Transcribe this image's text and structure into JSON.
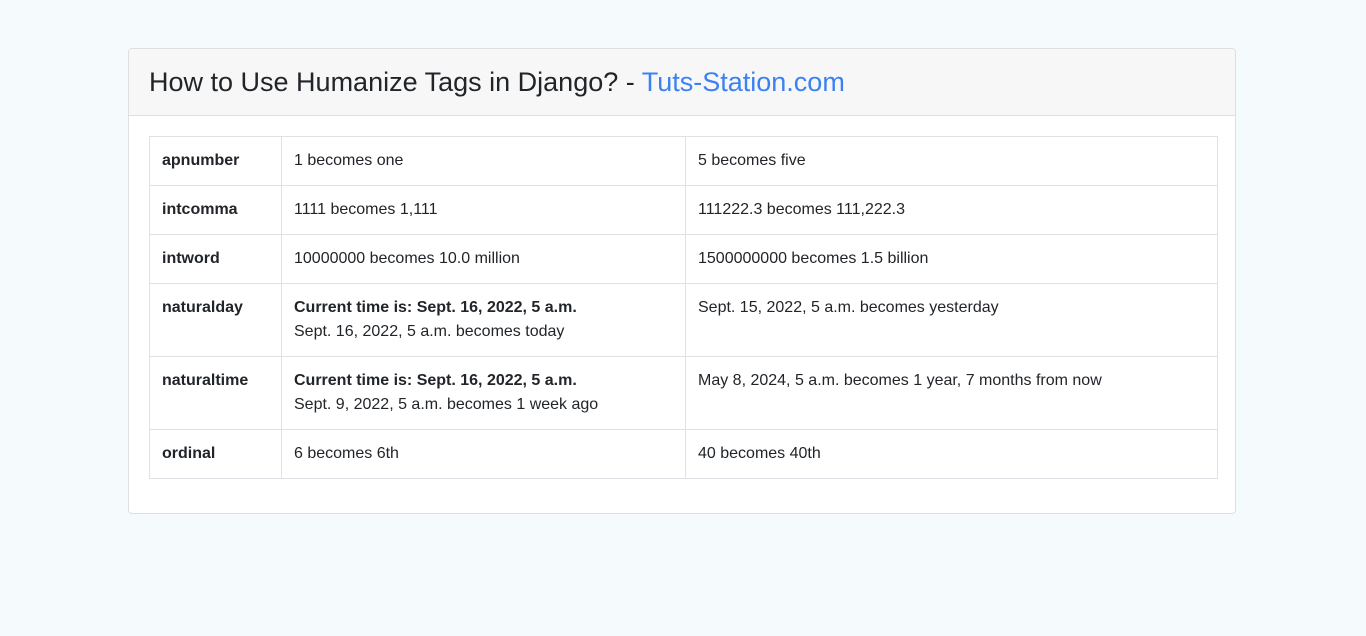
{
  "header": {
    "title": "How to Use Humanize Tags in Django? - ",
    "site_link": "Tuts-Station.com",
    "accent_color": "#3b82f0"
  },
  "rows": [
    {
      "label": "apnumber",
      "c1_bold": "",
      "c1_text": "1 becomes one",
      "c2_text": "5 becomes five"
    },
    {
      "label": "intcomma",
      "c1_bold": "",
      "c1_text": "1111 becomes 1,111",
      "c2_text": "111222.3 becomes 111,222.3"
    },
    {
      "label": "intword",
      "c1_bold": "",
      "c1_text": "10000000 becomes 10.0 million",
      "c2_text": "1500000000 becomes 1.5 billion"
    },
    {
      "label": "naturalday",
      "c1_bold": "Current time is: Sept. 16, 2022, 5 a.m.",
      "c1_text": "Sept. 16, 2022, 5 a.m. becomes today",
      "c2_text": "Sept. 15, 2022, 5 a.m. becomes yesterday"
    },
    {
      "label": "naturaltime",
      "c1_bold": "Current time is: Sept. 16, 2022, 5 a.m.",
      "c1_text": "Sept. 9, 2022, 5 a.m. becomes 1 week ago",
      "c2_text": "May 8, 2024, 5 a.m. becomes 1 year, 7 months from now"
    },
    {
      "label": "ordinal",
      "c1_bold": "",
      "c1_text": "6 becomes 6th",
      "c2_text": "40 becomes 40th"
    }
  ]
}
